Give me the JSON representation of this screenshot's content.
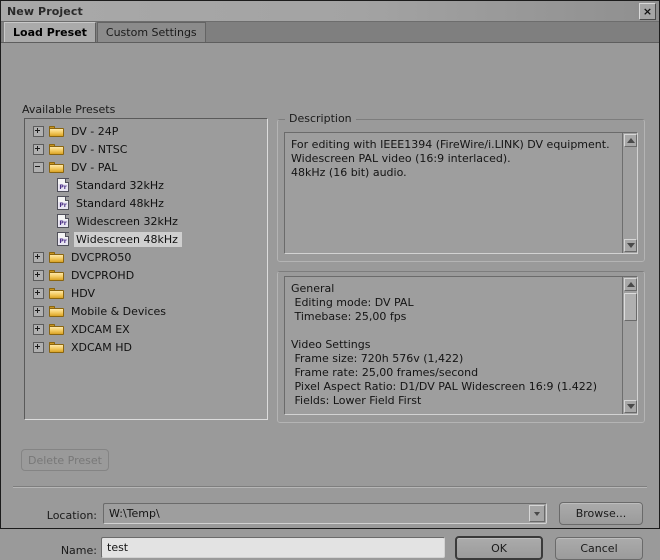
{
  "window": {
    "title": "New Project",
    "close_label": "×",
    "close_icon": "close-icon"
  },
  "tabs": [
    {
      "label": "Load Preset",
      "active": true
    },
    {
      "label": "Custom Settings",
      "active": false
    }
  ],
  "presets": {
    "label": "Available Presets",
    "tree": [
      {
        "label": "DV - 24P",
        "type": "folder",
        "state": "collapsed",
        "indent": 0,
        "selected": false
      },
      {
        "label": "DV - NTSC",
        "type": "folder",
        "state": "collapsed",
        "indent": 0,
        "selected": false
      },
      {
        "label": "DV - PAL",
        "type": "folder",
        "state": "expanded",
        "indent": 0,
        "selected": false
      },
      {
        "label": "Standard 32kHz",
        "type": "preset",
        "state": "none",
        "indent": 1,
        "selected": false
      },
      {
        "label": "Standard 48kHz",
        "type": "preset",
        "state": "none",
        "indent": 1,
        "selected": false
      },
      {
        "label": "Widescreen 32kHz",
        "type": "preset",
        "state": "none",
        "indent": 1,
        "selected": false
      },
      {
        "label": "Widescreen 48kHz",
        "type": "preset",
        "state": "none",
        "indent": 1,
        "selected": true
      },
      {
        "label": "DVCPRO50",
        "type": "folder",
        "state": "collapsed",
        "indent": 0,
        "selected": false
      },
      {
        "label": "DVCPROHD",
        "type": "folder",
        "state": "collapsed",
        "indent": 0,
        "selected": false
      },
      {
        "label": "HDV",
        "type": "folder",
        "state": "collapsed",
        "indent": 0,
        "selected": false
      },
      {
        "label": "Mobile & Devices",
        "type": "folder",
        "state": "collapsed",
        "indent": 0,
        "selected": false
      },
      {
        "label": "XDCAM EX",
        "type": "folder",
        "state": "collapsed",
        "indent": 0,
        "selected": false
      },
      {
        "label": "XDCAM HD",
        "type": "folder",
        "state": "collapsed",
        "indent": 0,
        "selected": false
      }
    ]
  },
  "description": {
    "group_title": "Description",
    "text": "For editing with IEEE1394 (FireWire/i.LINK) DV equipment.\nWidescreen PAL video (16:9 interlaced).\n48kHz (16 bit) audio."
  },
  "settings": {
    "text": "General\n Editing mode: DV PAL\n Timebase: 25,00 fps\n\nVideo Settings\n Frame size: 720h 576v (1,422)\n Frame rate: 25,00 frames/second\n Pixel Aspect Ratio: D1/DV PAL Widescreen 16:9 (1.422)\n Fields: Lower Field First"
  },
  "actions": {
    "delete_preset": "Delete Preset",
    "browse": "Browse...",
    "ok": "OK",
    "cancel": "Cancel"
  },
  "form": {
    "location_label": "Location:",
    "location_value": "W:\\Temp\\",
    "name_label": "Name:",
    "name_value": "test",
    "name_placeholder": ""
  },
  "colors": {
    "window_bg": "#9a9a9a",
    "titlebar": "#a7a7a7",
    "tab_active": "#aaaaaa",
    "selection": "#cfcfcf",
    "folder": "#f2c85c",
    "preset_accent": "#4b2f86"
  }
}
